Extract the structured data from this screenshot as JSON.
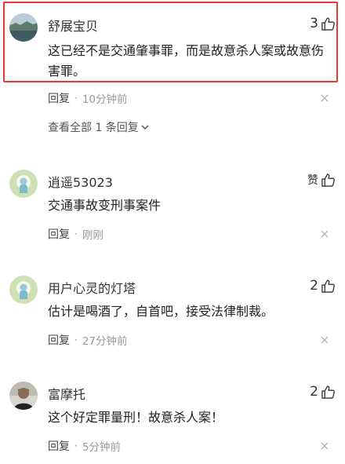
{
  "comments": [
    {
      "username": "舒展宝贝",
      "like_count": "3",
      "text": "这已经不是交通肇事罪，而是故意杀人案或故意伤害罪。",
      "reply_label": "回复",
      "separator": "·",
      "time": "10分钟前",
      "highlighted": true,
      "view_replies": "查看全部 1 条回复"
    },
    {
      "username": "逍遥53023",
      "like_label": "赞",
      "text": "交通事故变刑事案件",
      "reply_label": "回复",
      "separator": "·",
      "time": "刚刚"
    },
    {
      "username": "用户心灵的灯塔",
      "like_count": "2",
      "text": "估计是喝酒了，自首吧，接受法律制裁。",
      "reply_label": "回复",
      "separator": "·",
      "time": "27分钟前"
    },
    {
      "username": "富摩托",
      "like_count": "2",
      "text": "这个好定罪量刑！故意杀人案！",
      "reply_label": "回复",
      "separator": "·",
      "time": "5分钟前"
    }
  ],
  "colors": {
    "highlight_border": "#e8392e",
    "meta_gray": "#999999"
  },
  "icons": [
    "thumb-up-icon",
    "close-icon",
    "chevron-down-icon"
  ]
}
